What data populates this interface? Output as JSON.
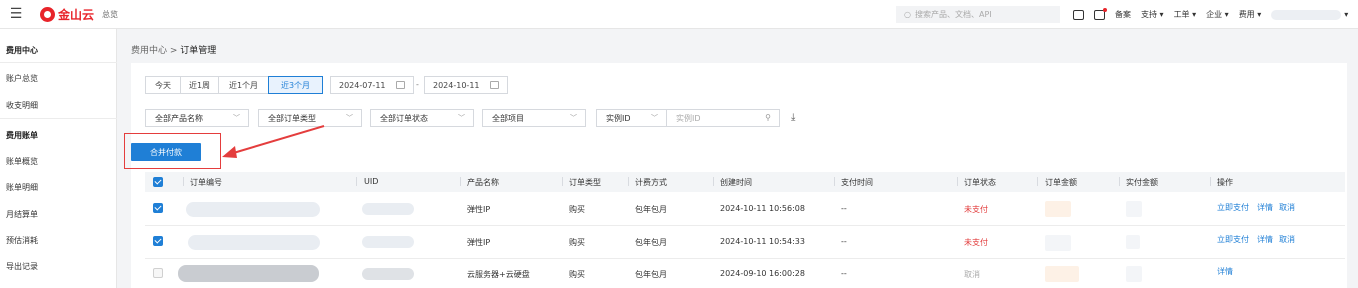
{
  "topbar": {
    "menu_icon": "hamburger-icon",
    "logo_text": "金山云",
    "overview": "总览",
    "search_placeholder": "搜索产品、文档、API",
    "record": "备案",
    "support": "支持",
    "ticket": "工单",
    "enterprise": "企业",
    "billing": "费用"
  },
  "sidebar": {
    "cost_center": "费用中心",
    "account_overview": "账户总览",
    "income_expense": "收支明细",
    "cost_bill": "费用账单",
    "bill_overview": "账单概览",
    "bill_detail": "账单明细",
    "monthly_statement": "月结算单",
    "estimated_usage": "预估消耗",
    "export_records": "导出记录"
  },
  "breadcrumb": {
    "parent": "费用中心",
    "separator": " > ",
    "current": "订单管理"
  },
  "filters": {
    "ranges": [
      "今天",
      "近1周",
      "近1个月",
      "近3个月"
    ],
    "active_range": "近3个月",
    "start_date": "2024-07-11",
    "end_date": "2024-10-11",
    "date_sep": "-",
    "product": "全部产品名称",
    "order_type": "全部订单类型",
    "order_status": "全部订单状态",
    "project": "全部项目",
    "instance_select": "实例ID",
    "instance_placeholder": "实例ID"
  },
  "merge_pay_label": "合并付款",
  "table": {
    "headers": [
      "订单编号",
      "UID",
      "产品名称",
      "订单类型",
      "计费方式",
      "创建时间",
      "支付时间",
      "订单状态",
      "订单金额",
      "实付金额",
      "操作"
    ],
    "rows": [
      {
        "product": "弹性IP",
        "type": "购买",
        "billing": "包年包月",
        "created": "2024-10-11 10:56:08",
        "paid": "--",
        "status": "未支付",
        "actions": [
          "立即支付",
          "详情",
          "取消"
        ]
      },
      {
        "product": "弹性IP",
        "type": "购买",
        "billing": "包年包月",
        "created": "2024-10-11 10:54:33",
        "paid": "--",
        "status": "未支付",
        "actions": [
          "立即支付",
          "详情",
          "取消"
        ]
      },
      {
        "product": "云服务器+云硬盘",
        "type": "购买",
        "billing": "包年包月",
        "created": "2024-09-10 16:00:28",
        "paid": "--",
        "status": "取消",
        "actions": [
          "详情"
        ]
      }
    ]
  },
  "colors": {
    "accent": "#1f7fd6",
    "danger": "#e23c3c",
    "brand": "#e8242a"
  }
}
